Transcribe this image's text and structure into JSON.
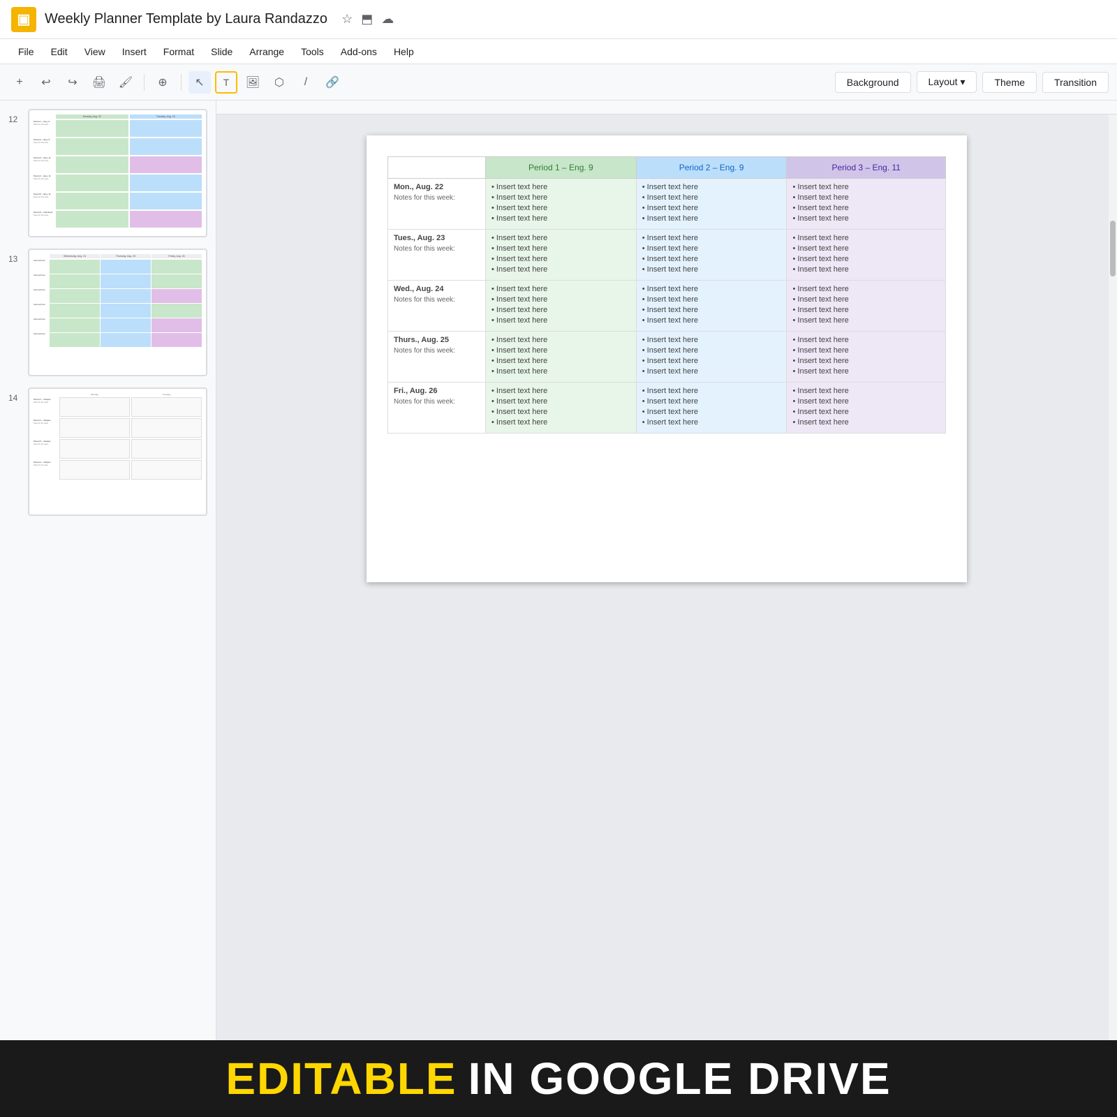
{
  "app": {
    "icon": "▣",
    "title": "Weekly Planner Template by Laura Randazzo",
    "star_icon": "☆",
    "folder_icon": "⬒",
    "cloud_icon": "☁"
  },
  "menu": {
    "items": [
      "File",
      "Edit",
      "View",
      "Insert",
      "Format",
      "Slide",
      "Arrange",
      "Tools",
      "Add-ons",
      "Help"
    ]
  },
  "toolbar": {
    "add_label": "+",
    "undo_label": "↩",
    "redo_label": "↪",
    "print_label": "🖨",
    "paint_label": "🖌",
    "zoom_label": "⊕",
    "select_label": "↖",
    "text_label": "T",
    "image_label": "🖼",
    "shapes_label": "⬡",
    "line_label": "/",
    "link_label": "🔗",
    "background_btn": "Background",
    "layout_btn": "Layout ▾",
    "theme_btn": "Theme",
    "transition_btn": "Transition"
  },
  "slides": [
    {
      "num": "12",
      "type": "two-col"
    },
    {
      "num": "13",
      "type": "three-col"
    },
    {
      "num": "14",
      "type": "blank-rows"
    }
  ],
  "slide": {
    "periods": [
      {
        "label": "Period 1 – Eng. 9",
        "color_class": "period-1-header"
      },
      {
        "label": "Period 2 – Eng. 9",
        "color_class": "period-2-header"
      },
      {
        "label": "Period 3 – Eng. 11",
        "color_class": "period-3-header"
      }
    ],
    "days": [
      {
        "name": "Mon., Aug. 22",
        "notes": "Notes for this week:"
      },
      {
        "name": "Tues., Aug. 23",
        "notes": "Notes for this week:"
      },
      {
        "name": "Wed., Aug. 24",
        "notes": "Notes for this week:"
      },
      {
        "name": "Thurs., Aug. 25",
        "notes": "Notes for this week:"
      },
      {
        "name": "Fri., Aug. 26",
        "notes": "Notes for this week:"
      }
    ],
    "insert_text": "Insert text here",
    "bullet_text": "Insert text here"
  },
  "banner": {
    "editable": "EDITABLE",
    "rest": " IN GOOGLE DRIVE"
  }
}
